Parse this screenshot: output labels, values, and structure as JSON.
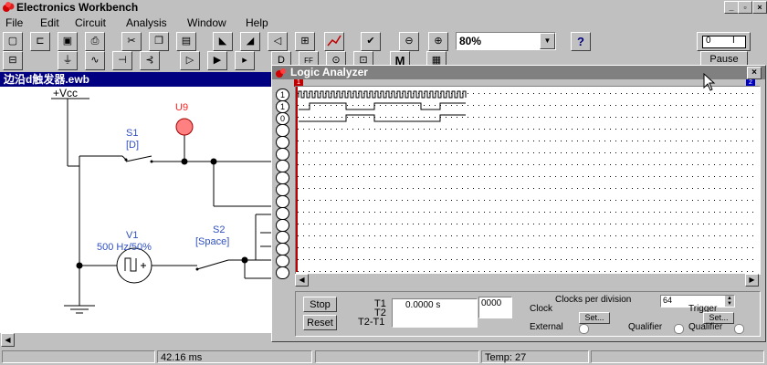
{
  "app": {
    "title": "Electronics Workbench"
  },
  "menu": [
    "File",
    "Edit",
    "Circuit",
    "Analysis",
    "Window",
    "Help"
  ],
  "toolbar": {
    "zoom": "80%",
    "help": "?",
    "pause": "Pause",
    "power_on": "I",
    "power_off": "0",
    "parts_m": "M"
  },
  "circuit": {
    "window_title": "边沿d触发器.ewb",
    "vcc": "+Vcc",
    "u9": "U9",
    "s1": "S1",
    "s1_key": "[D]",
    "v1": "V1",
    "v1_spec": "500 Hz/50%",
    "s2": "S2",
    "s2_key": "[Space]"
  },
  "analyzer": {
    "title": "Logic Analyzer",
    "channel_labels": [
      "1",
      "1",
      "0",
      "",
      "",
      "",
      "",
      "",
      "",
      "",
      "",
      "",
      "",
      "",
      "",
      ""
    ],
    "stop": "Stop",
    "reset": "Reset",
    "t1": "T1",
    "t2": "T2",
    "t21": "T2-T1",
    "time_value": "0.0000  s",
    "hex_value": "0000",
    "clocks_label": "Clocks per division",
    "clocks_value": "64",
    "clock_label": "Clock",
    "trigger_label": "Trigger",
    "set_label": "Set...",
    "external_label": "External",
    "qualifier_label": "Qualifier",
    "marker1": "1",
    "marker2": "2"
  },
  "status": {
    "time": "42.16 ms",
    "temp": "Temp:  27"
  }
}
